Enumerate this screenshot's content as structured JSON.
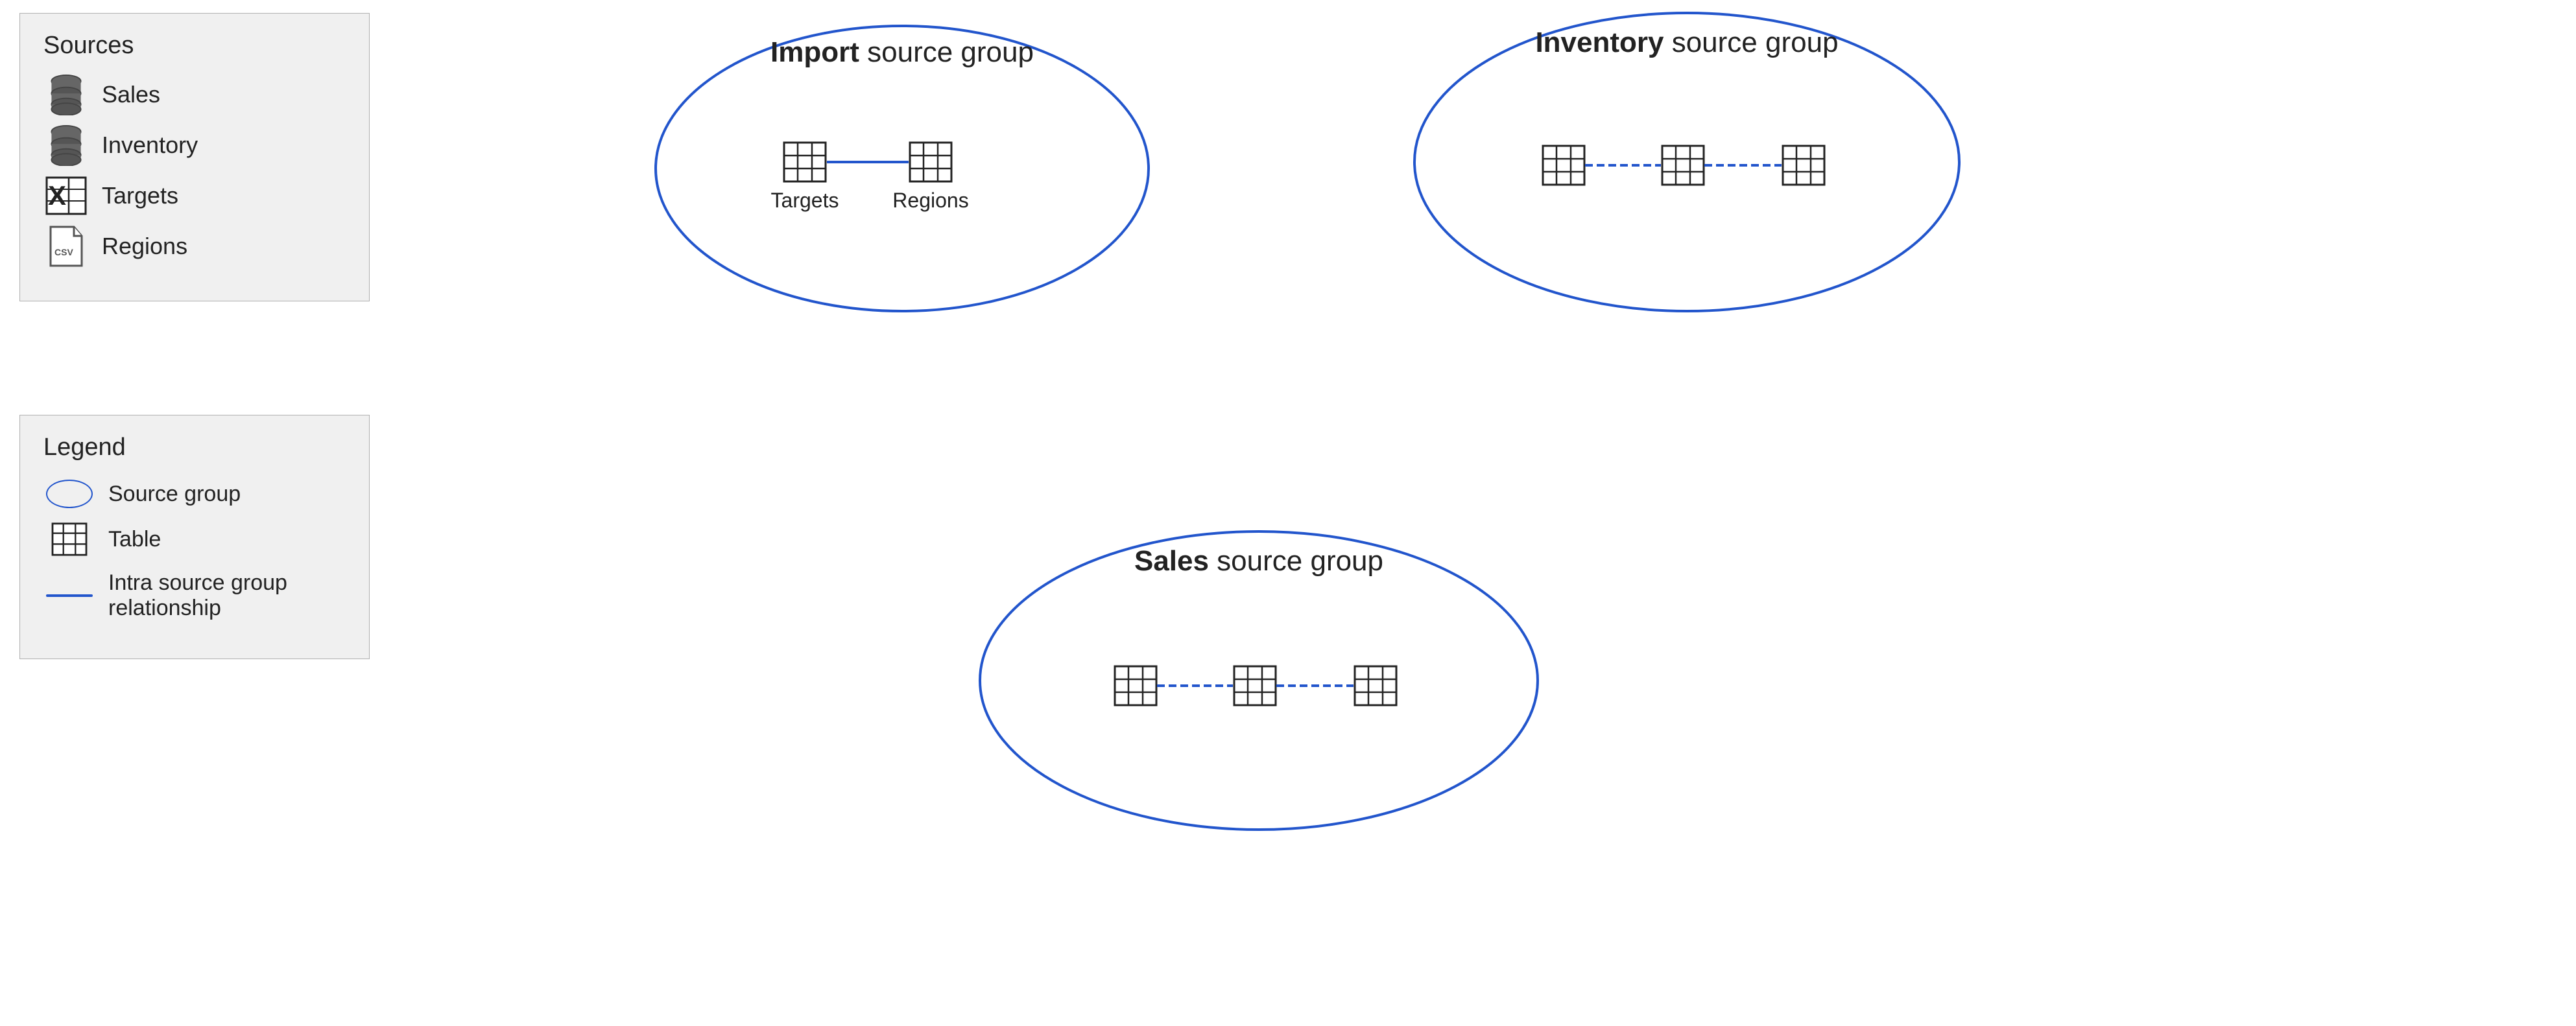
{
  "sources": {
    "title": "Sources",
    "items": [
      {
        "id": "sales",
        "label": "Sales",
        "icon": "database"
      },
      {
        "id": "inventory",
        "label": "Inventory",
        "icon": "database"
      },
      {
        "id": "targets",
        "label": "Targets",
        "icon": "excel"
      },
      {
        "id": "regions",
        "label": "Regions",
        "icon": "csv"
      }
    ]
  },
  "legend": {
    "title": "Legend",
    "items": [
      {
        "id": "source-group",
        "label": "Source group",
        "icon": "oval"
      },
      {
        "id": "table",
        "label": "Table",
        "icon": "table"
      },
      {
        "id": "relationship",
        "label": "Intra source group relationship",
        "icon": "line"
      }
    ]
  },
  "groups": [
    {
      "id": "import",
      "label_bold": "Import",
      "label_rest": " source group",
      "tables": [
        {
          "id": "targets",
          "label": "Targets"
        },
        {
          "id": "regions",
          "label": "Regions"
        }
      ]
    },
    {
      "id": "inventory",
      "label_bold": "Inventory",
      "label_rest": " source group",
      "tables": [
        {
          "id": "t1",
          "label": ""
        },
        {
          "id": "t2",
          "label": ""
        },
        {
          "id": "t3",
          "label": ""
        }
      ]
    },
    {
      "id": "sales",
      "label_bold": "Sales",
      "label_rest": " source group",
      "tables": [
        {
          "id": "t1",
          "label": ""
        },
        {
          "id": "t2",
          "label": ""
        },
        {
          "id": "t3",
          "label": ""
        }
      ]
    }
  ],
  "colors": {
    "ellipse_stroke": "#2255cc",
    "connector": "#2255cc",
    "panel_bg": "#f0f0f0",
    "panel_border": "#b0b0b0"
  }
}
